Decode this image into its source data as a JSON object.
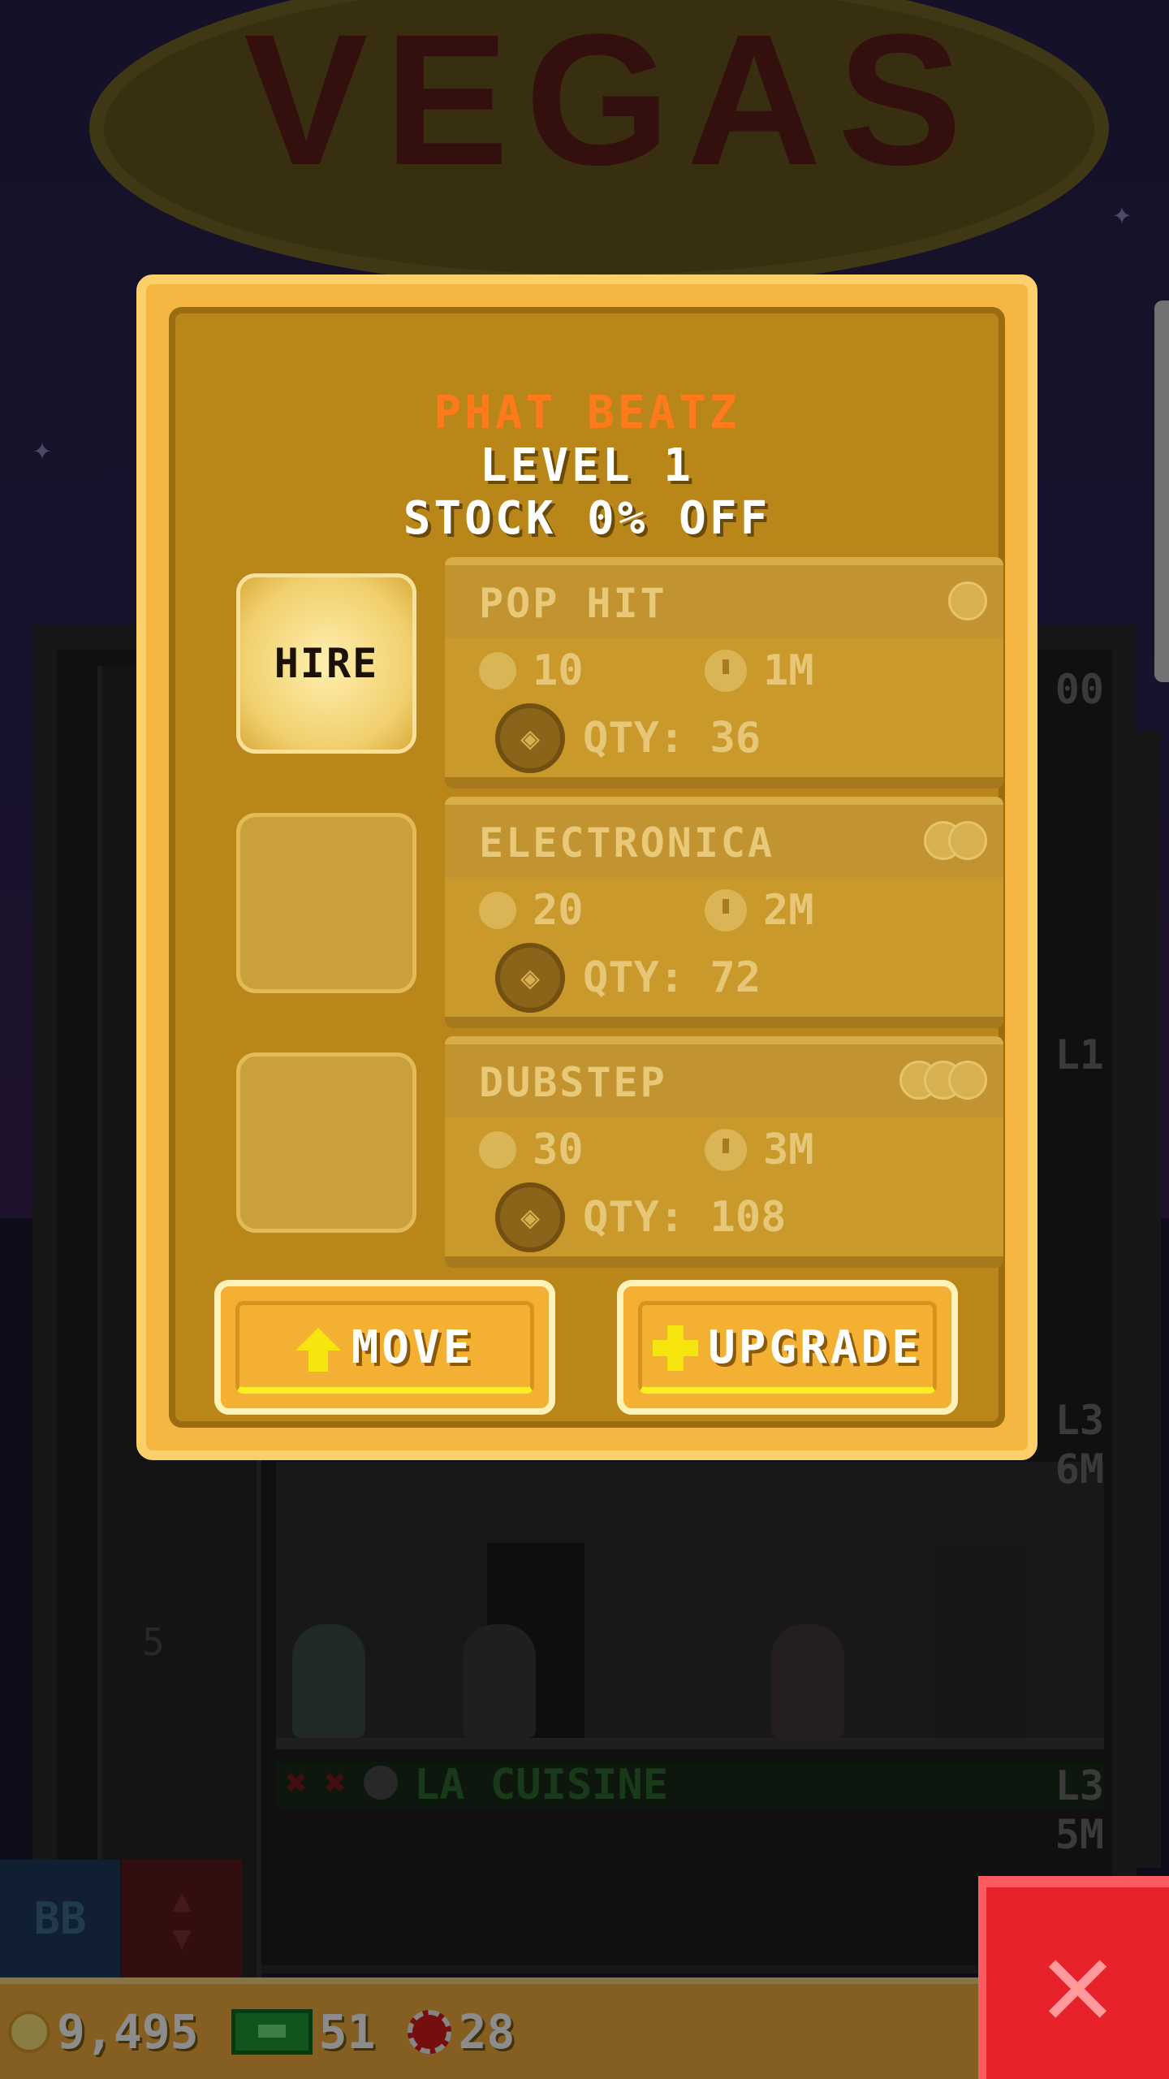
{
  "background": {
    "sign_text": "VEGAS",
    "floor_number": "5",
    "floor_name": "LA CUISINE",
    "side_labels": [
      "00",
      "L1",
      "L3",
      "6M",
      "L3",
      "5M"
    ]
  },
  "dialog": {
    "business_name": "PHAT BEATZ",
    "level": "LEVEL 1",
    "stock_discount": "STOCK 0% OFF",
    "hire_label": "HIRE",
    "products": [
      {
        "name": "POP HIT",
        "cost": "10",
        "time": "1M",
        "qty": "QTY: 36",
        "coin_icons": 1
      },
      {
        "name": "ELECTRONICA",
        "cost": "20",
        "time": "2M",
        "qty": "QTY: 72",
        "coin_icons": 2
      },
      {
        "name": "DUBSTEP",
        "cost": "30",
        "time": "3M",
        "qty": "QTY: 108",
        "coin_icons": 3
      }
    ],
    "move_label": "MOVE",
    "upgrade_label": "UPGRADE"
  },
  "bottom_controls": {
    "bb_label": "BB"
  },
  "bottom_bar": {
    "coins": "9,495",
    "bux": "51",
    "chips": "28"
  },
  "colors": {
    "business_name": "#ff7a1a",
    "dialog_frame": "#f4b641",
    "dialog_inner": "#b98619",
    "close_button": "#e8222a",
    "bottom_bar": "#f2ae3c"
  }
}
